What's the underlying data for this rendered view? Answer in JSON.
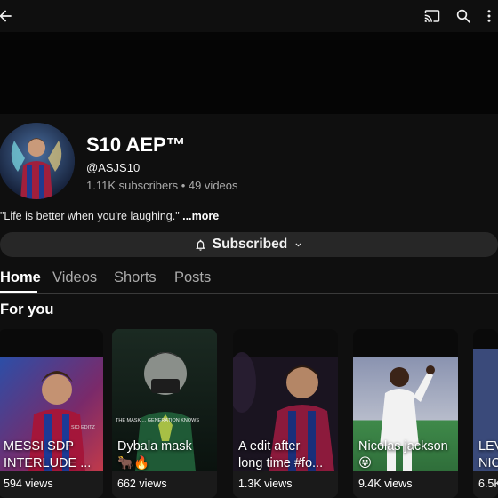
{
  "channel": {
    "name": "S10 AEP™",
    "handle": "@ASJS10",
    "stats": "1.11K subscribers • 49 videos",
    "description": "\"Life is better when you're laughing.\"",
    "more_label": "...more",
    "subscribed_label": "Subscribed"
  },
  "tabs": [
    {
      "label": "Home"
    },
    {
      "label": "Videos"
    },
    {
      "label": "Shorts"
    },
    {
      "label": "Posts"
    }
  ],
  "section": {
    "title": "For you"
  },
  "shorts": [
    {
      "title_line1": "MESSI SDP",
      "title_line2": "INTERLUDE ...",
      "views": "594 views",
      "thumb_text": "SIO EDITZ"
    },
    {
      "title_line1": "Dybala mask",
      "title_line2": "🐂🔥",
      "views": "662 views",
      "thumb_text": "THE MASK ... GENERATION KNOWS"
    },
    {
      "title_line1": "A edit after",
      "title_line2": "long time #fo...",
      "views": "1.3K views"
    },
    {
      "title_line1": "Nicolas jackson",
      "title_line2": "😛",
      "views": "9.4K views"
    },
    {
      "title_line1": "LEV",
      "title_line2": "NIC",
      "views": "6.5K"
    }
  ],
  "colors": {
    "background": "#0f0f0f",
    "button_bg": "#272727",
    "text_secondary": "#aaaaaa"
  },
  "icons": [
    "back-arrow-icon",
    "cast-icon",
    "search-icon",
    "more-vert-icon",
    "bell-icon",
    "chevron-down-icon"
  ]
}
